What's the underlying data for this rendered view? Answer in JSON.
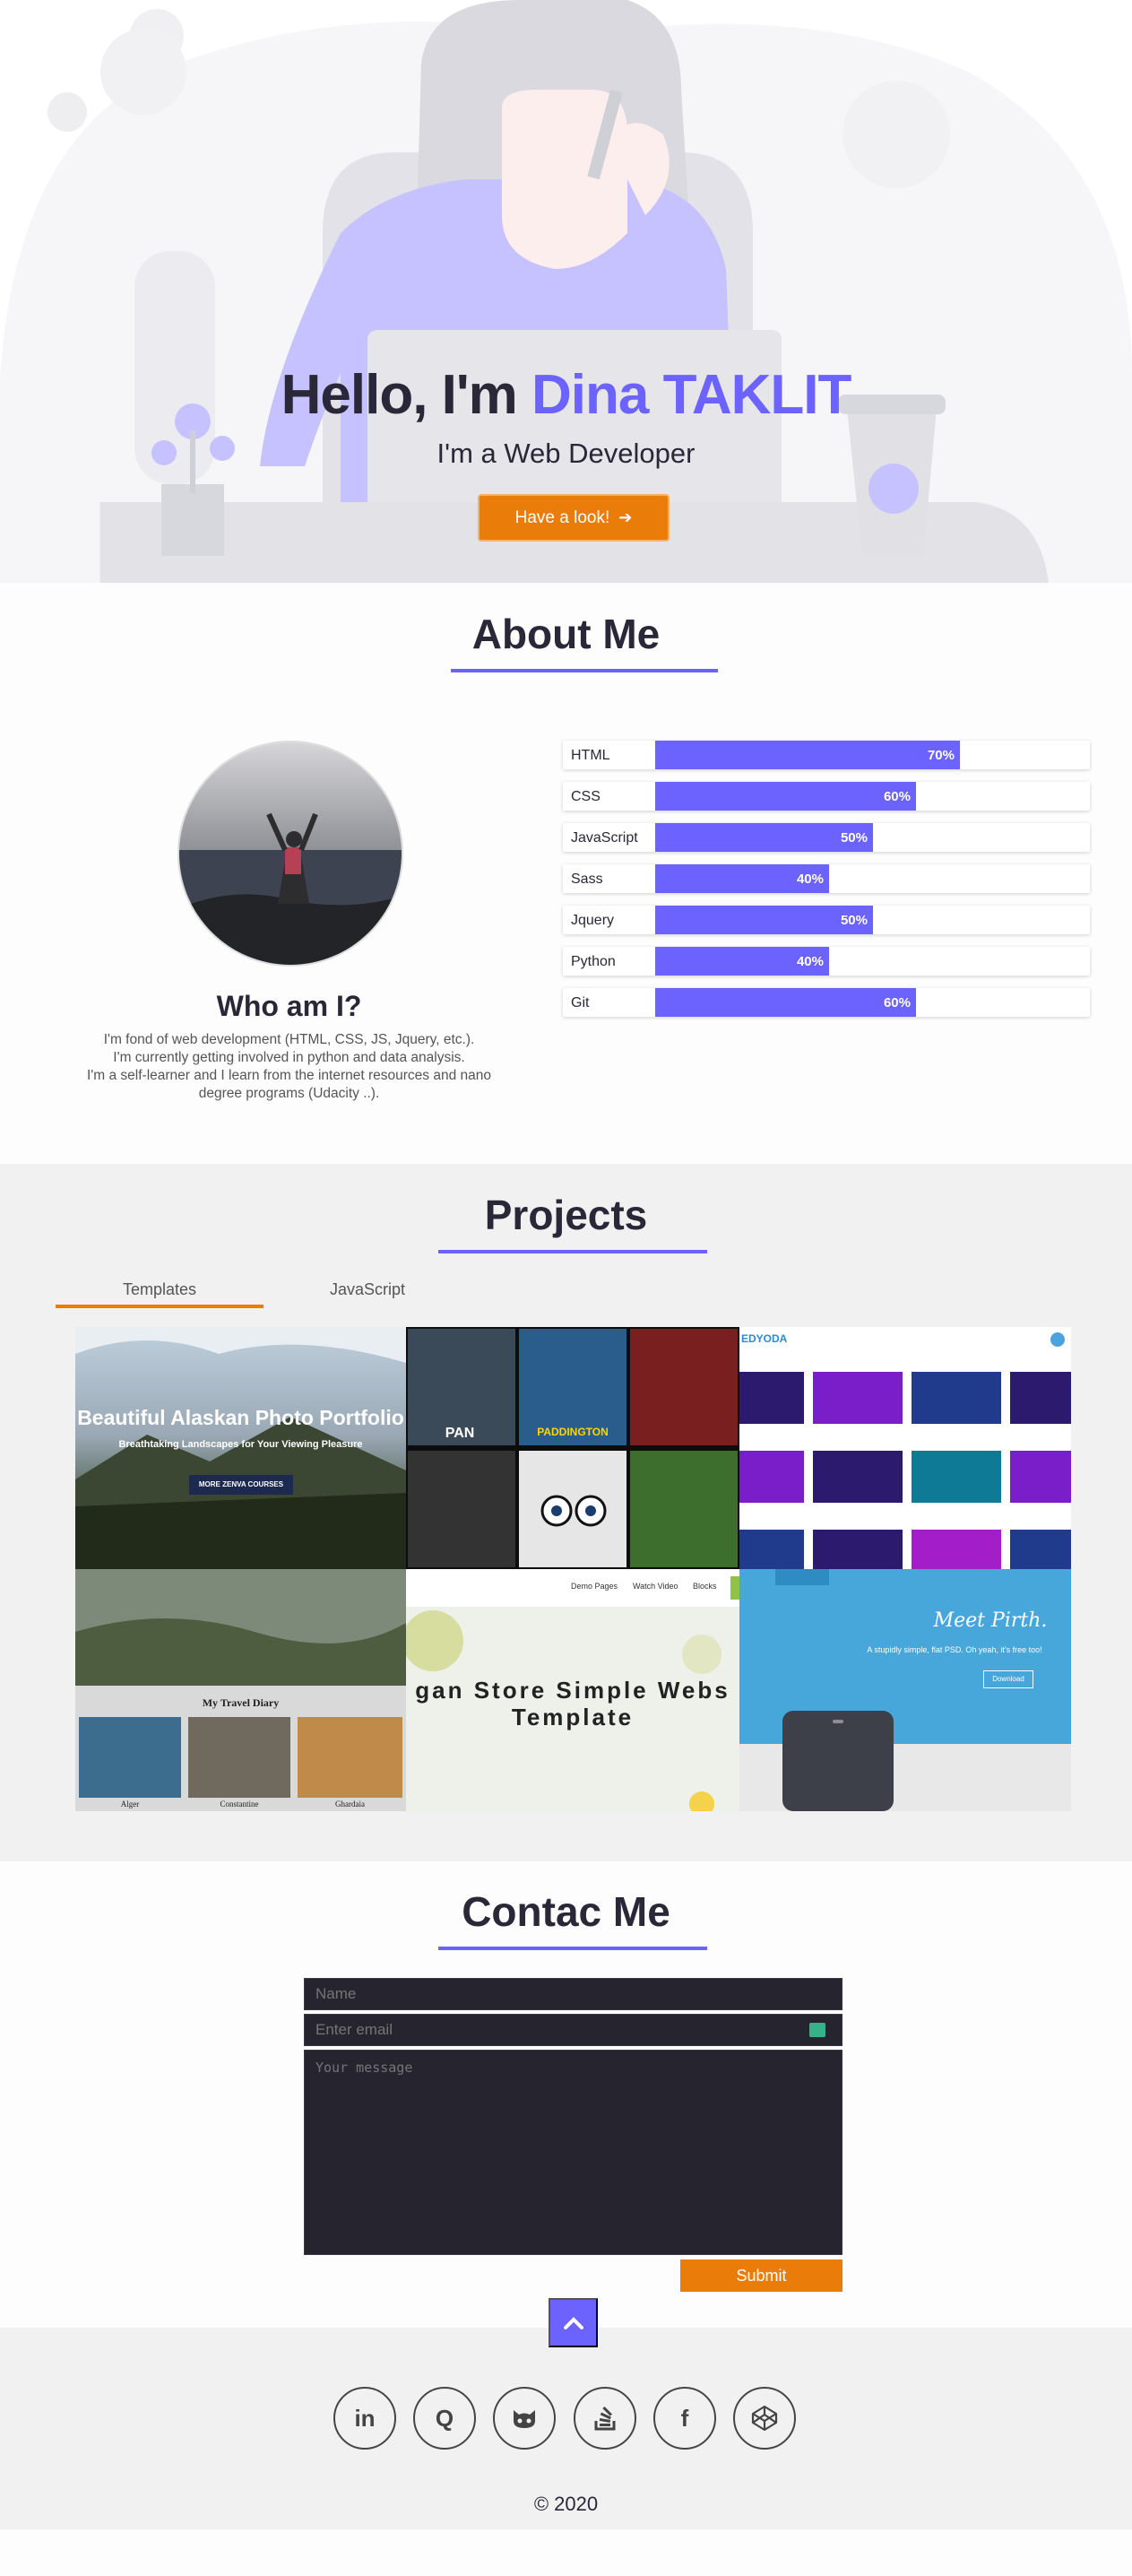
{
  "hero": {
    "greeting": "Hello, I'm",
    "name": "Dina TAKLIT",
    "subtitle": "I'm a Web Developer",
    "cta_label": "Have a look!"
  },
  "about": {
    "title": "About Me",
    "who_title": "Who am I?",
    "bio_lines": [
      "I'm fond of web development (HTML, CSS, JS, Jquery, etc.).",
      "I'm currently getting involved in python and data analysis.",
      "I'm a self-learner and I learn from the internet resources and nano",
      "degree programs (Udacity ..)."
    ],
    "skills": [
      {
        "name": "HTML",
        "percent": 70,
        "label": "70%"
      },
      {
        "name": "CSS",
        "percent": 60,
        "label": "60%"
      },
      {
        "name": "JavaScript",
        "percent": 50,
        "label": "50%"
      },
      {
        "name": "Sass",
        "percent": 40,
        "label": "40%"
      },
      {
        "name": "Jquery",
        "percent": 50,
        "label": "50%"
      },
      {
        "name": "Python",
        "percent": 40,
        "label": "40%"
      },
      {
        "name": "Git",
        "percent": 60,
        "label": "60%"
      }
    ]
  },
  "projects": {
    "title": "Projects",
    "tabs": [
      "Templates",
      "JavaScript"
    ],
    "tile1_title": "Beautiful Alaskan Photo Portfolio",
    "tile1_sub": "Breathtaking Landscapes for Your Viewing Pleasure",
    "tile1_btn": "MORE ZENVA COURSES",
    "tile2_poster1": "PAN",
    "tile2_poster2": "PADDINGTON",
    "tile3_brand": "EDYODA",
    "tile4_heading": "My Travel Diary",
    "tile4_captions": [
      "Alger",
      "Constantine",
      "Ghardaia"
    ],
    "tile5_nav": [
      "Demo Pages",
      "Watch Video",
      "Blocks"
    ],
    "tile5_title": "gan Store Simple Webs Template",
    "tile6_title": "Meet Pirth.",
    "tile6_sub": "A stupidly simple, flat PSD. Oh yeah, it's free too!",
    "tile6_btn": "Download"
  },
  "contact": {
    "title": "Contac Me",
    "name_placeholder": "Name",
    "email_placeholder": "Enter email",
    "message_placeholder": "Your message",
    "submit_label": "Submit"
  },
  "footer": {
    "social": [
      {
        "icon": "linkedin-icon",
        "glyph": "in"
      },
      {
        "icon": "quora-icon",
        "glyph": "Q"
      },
      {
        "icon": "github-icon",
        "glyph": ""
      },
      {
        "icon": "stackoverflow-icon",
        "glyph": ""
      },
      {
        "icon": "facebook-icon",
        "glyph": "f"
      },
      {
        "icon": "codepen-icon",
        "glyph": ""
      }
    ],
    "copyright": "© 2020"
  },
  "colors": {
    "accent": "#6c63ff",
    "orange": "#ea7d0a",
    "dark": "#2a2838"
  }
}
